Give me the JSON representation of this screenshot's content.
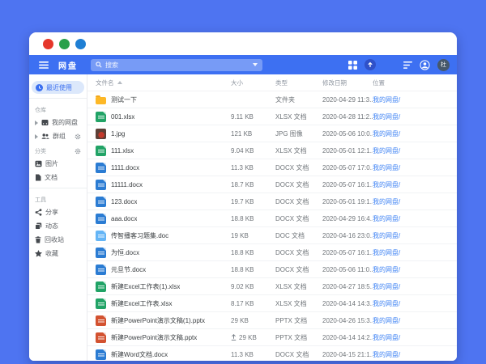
{
  "titlebar": {
    "dots": [
      "red",
      "green",
      "blue"
    ]
  },
  "appbar": {
    "title": "网盘",
    "search_placeholder": "搜索",
    "avatar_text": "杜"
  },
  "sidebar": {
    "active": {
      "label": "最近使用"
    },
    "sections": [
      {
        "label": "仓库",
        "items": [
          {
            "label": "我的网盘"
          },
          {
            "label": "群组"
          }
        ]
      },
      {
        "label": "分类",
        "items": [
          {
            "label": "图片"
          },
          {
            "label": "文档"
          }
        ]
      },
      {
        "label": "工具",
        "items": [
          {
            "label": "分享"
          },
          {
            "label": "动态"
          },
          {
            "label": "回收站"
          },
          {
            "label": "收藏"
          }
        ]
      }
    ]
  },
  "table": {
    "columns": [
      "文件名",
      "大小",
      "类型",
      "修改日期",
      "位置"
    ],
    "rows": [
      {
        "name": "测试一下",
        "kind": "folder",
        "size": "",
        "type": "文件夹",
        "date": "2020-04-29 11:3...",
        "location": "我的网盘/"
      },
      {
        "name": "001.xlsx",
        "kind": "xlsx",
        "size": "9.11 KB",
        "type": "XLSX 文档",
        "date": "2020-04-28 11:2...",
        "location": "我的网盘/"
      },
      {
        "name": "1.jpg",
        "kind": "jpg",
        "size": "121 KB",
        "type": "JPG 图像",
        "date": "2020-05-06 10:0...",
        "location": "我的网盘/"
      },
      {
        "name": "111.xlsx",
        "kind": "xlsx",
        "size": "9.04 KB",
        "type": "XLSX 文档",
        "date": "2020-05-01 12:1...",
        "location": "我的网盘/"
      },
      {
        "name": "1111.docx",
        "kind": "docx",
        "size": "11.3 KB",
        "type": "DOCX 文档",
        "date": "2020-05-07 17:0...",
        "location": "我的网盘/"
      },
      {
        "name": "11111.docx",
        "kind": "docx",
        "size": "18.7 KB",
        "type": "DOCX 文档",
        "date": "2020-05-07 16:1...",
        "location": "我的网盘/"
      },
      {
        "name": "123.docx",
        "kind": "docx",
        "size": "19.7 KB",
        "type": "DOCX 文档",
        "date": "2020-05-01 19:1...",
        "location": "我的网盘/"
      },
      {
        "name": "aaa.docx",
        "kind": "docx",
        "size": "18.8 KB",
        "type": "DOCX 文档",
        "date": "2020-04-29 16:4...",
        "location": "我的网盘/"
      },
      {
        "name": "传智播客习题集.doc",
        "kind": "doc",
        "size": "19 KB",
        "type": "DOC 文档",
        "date": "2020-04-16 23:0...",
        "location": "我的网盘/"
      },
      {
        "name": "为恒.docx",
        "kind": "docx",
        "size": "18.8 KB",
        "type": "DOCX 文档",
        "date": "2020-05-07 16:1...",
        "location": "我的网盘/"
      },
      {
        "name": "元旦节.docx",
        "kind": "docx",
        "size": "18.8 KB",
        "type": "DOCX 文档",
        "date": "2020-05-06 11:0...",
        "location": "我的网盘/"
      },
      {
        "name": "新建Excel工作表(1).xlsx",
        "kind": "xlsx",
        "size": "9.02 KB",
        "type": "XLSX 文档",
        "date": "2020-04-27 18:5...",
        "location": "我的网盘/"
      },
      {
        "name": "新建Excel工作表.xlsx",
        "kind": "xlsx",
        "size": "8.17 KB",
        "type": "XLSX 文档",
        "date": "2020-04-14 14:3...",
        "location": "我的网盘/"
      },
      {
        "name": "新建PowerPoint演示文稿(1).pptx",
        "kind": "pptx",
        "size": "29 KB",
        "type": "PPTX 文档",
        "date": "2020-04-26 15:3...",
        "location": "我的网盘/"
      },
      {
        "name": "新建PowerPoint演示文稿.pptx",
        "kind": "pptx",
        "size": "29 KB",
        "type": "PPTX 文档",
        "date": "2020-04-14 14:2...",
        "location": "我的网盘/",
        "upload": true
      },
      {
        "name": "新建Word文档.docx",
        "kind": "docx",
        "size": "11.3 KB",
        "type": "DOCX 文档",
        "date": "2020-04-15 21:1...",
        "location": "我的网盘/"
      }
    ]
  },
  "colors": {
    "frame": "#4e74f1",
    "appbar": "#3d70f2",
    "accent": "#3a6ff0",
    "link": "#4285f4"
  }
}
